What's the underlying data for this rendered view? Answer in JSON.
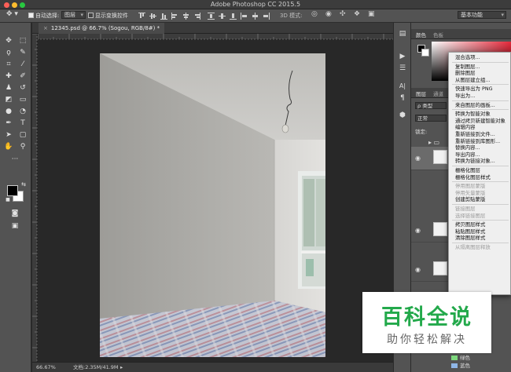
{
  "titlebar": {
    "title": "Adobe Photoshop CC 2015.5"
  },
  "options_bar": {
    "auto_select_label": "自动选择:",
    "auto_select_value": "图层",
    "show_transform_label": "显示变换控件",
    "mode_3d_label": "3D 模式:",
    "workspace": "基本功能"
  },
  "document": {
    "tab_label": "12345.psd @ 66.7% (Sogou, RGB/8#) *"
  },
  "status": {
    "zoom": "66.67%",
    "doc_info": "文档:2.35M/41.9M"
  },
  "panels": {
    "color_tabs": [
      "颜色",
      "色板"
    ],
    "layers_tabs": [
      "图层",
      "通道"
    ],
    "filter_kind": "ρ 类型",
    "blend_mode": "正常",
    "lock_label": "锁定:"
  },
  "context_menu": {
    "items": [
      {
        "label": "混合选项...",
        "disabled": false
      },
      {
        "sep": true
      },
      {
        "label": "复制图层...",
        "disabled": false
      },
      {
        "label": "删除图层",
        "disabled": false
      },
      {
        "label": "从图层建立组...",
        "disabled": false
      },
      {
        "sep": true
      },
      {
        "label": "快速导出为 PNG",
        "disabled": false
      },
      {
        "label": "导出为...",
        "disabled": false
      },
      {
        "sep": true
      },
      {
        "label": "来自图层的画板...",
        "disabled": false
      },
      {
        "sep": true
      },
      {
        "label": "转换为智能对象",
        "disabled": false
      },
      {
        "label": "通过拷贝新建智能对象",
        "disabled": false
      },
      {
        "label": "编辑内容",
        "disabled": false
      },
      {
        "label": "重新链接到文件...",
        "disabled": false
      },
      {
        "label": "重新链接到库图形...",
        "disabled": false
      },
      {
        "label": "替换内容...",
        "disabled": false
      },
      {
        "label": "导出内容...",
        "disabled": false
      },
      {
        "label": "转换为链接对象...",
        "disabled": false
      },
      {
        "sep": true
      },
      {
        "label": "栅格化图层",
        "disabled": false
      },
      {
        "label": "栅格化图层样式",
        "disabled": false
      },
      {
        "sep": true
      },
      {
        "label": "停用图层蒙版",
        "disabled": true
      },
      {
        "label": "停用矢量蒙版",
        "disabled": true
      },
      {
        "label": "创建剪贴蒙版",
        "disabled": false
      },
      {
        "sep": true
      },
      {
        "label": "链接图层",
        "disabled": true
      },
      {
        "label": "选择链接图层",
        "disabled": true
      },
      {
        "sep": true
      },
      {
        "label": "拷贝图层样式",
        "disabled": false
      },
      {
        "label": "粘贴图层样式",
        "disabled": false
      },
      {
        "label": "清除图层样式",
        "disabled": false
      },
      {
        "sep": true
      },
      {
        "label": "从隔离图层释放",
        "disabled": true
      }
    ]
  },
  "color_labels": [
    {
      "label": "绿色",
      "color": "#7ed87e"
    },
    {
      "label": "蓝色",
      "color": "#8fb6e6"
    }
  ],
  "watermark": {
    "title": "百科全说",
    "subtitle": "助你轻松解决"
  }
}
